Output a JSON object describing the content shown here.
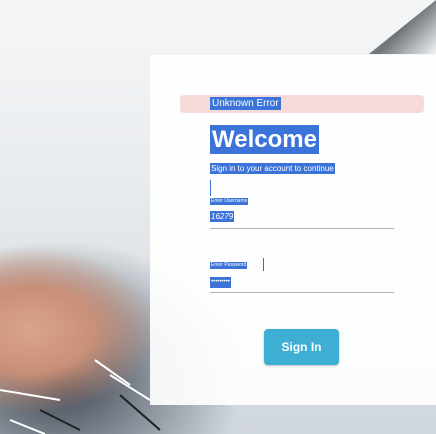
{
  "error": {
    "text": "Unknown Error"
  },
  "login": {
    "title": "Welcome",
    "subtitle": "Sign in to your account to continue",
    "username_label": "Enter Username",
    "username_value": "16279",
    "password_label": "Enter Password",
    "password_value": "•••••••••",
    "signin_label": "Sign In"
  },
  "colors": {
    "accent": "#3eaed3",
    "selection": "#3b73d9",
    "error_bg": "#f6d9d9"
  }
}
